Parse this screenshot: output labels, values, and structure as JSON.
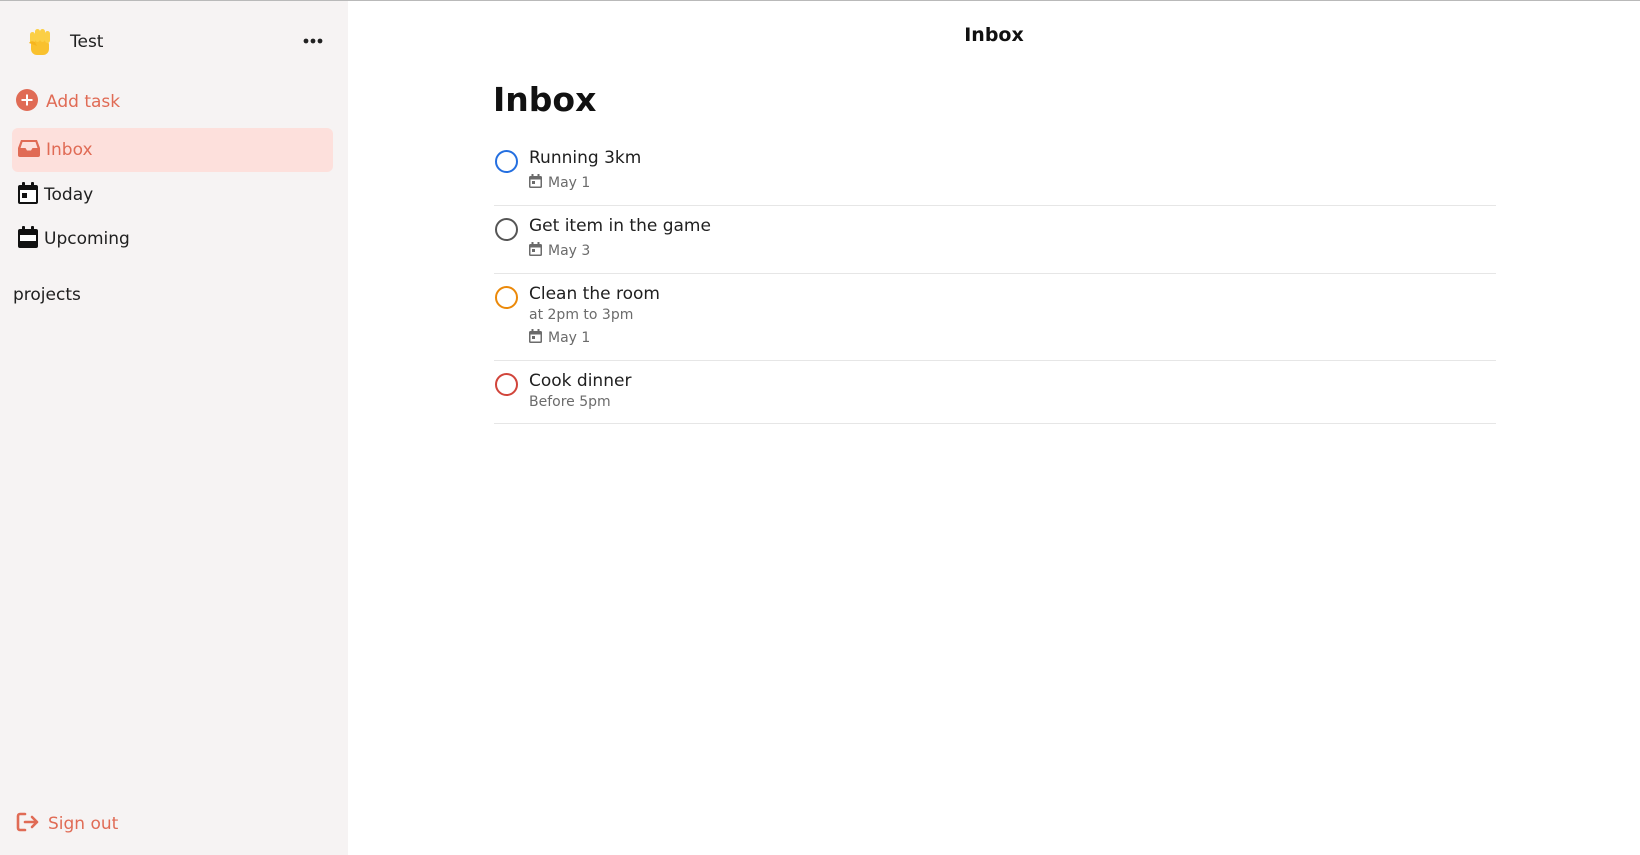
{
  "sidebar": {
    "user": {
      "name": "Test",
      "avatar_icon": "raised-fist-emoji"
    },
    "more_icon": "ellipsis-icon",
    "add_task_label": "Add task",
    "nav": [
      {
        "label": "Inbox",
        "icon": "inbox-icon",
        "active": true
      },
      {
        "label": "Today",
        "icon": "calendar-icon",
        "active": false
      },
      {
        "label": "Upcoming",
        "icon": "calendar-icon",
        "active": false
      }
    ],
    "projects_label": "projects",
    "sign_out_label": "Sign out"
  },
  "main": {
    "header_title": "Inbox",
    "page_title": "Inbox",
    "tasks": [
      {
        "title": "Running 3km",
        "description": "",
        "due": "May 1",
        "priority_color": "#246fe0"
      },
      {
        "title": "Get item in the game",
        "description": "",
        "due": "May 3",
        "priority_color": "#555555"
      },
      {
        "title": "Clean the room",
        "description": "at 2pm to 3pm",
        "due": "May 1",
        "priority_color": "#eb8909"
      },
      {
        "title": "Cook dinner",
        "description": "Before 5pm",
        "due": "",
        "priority_color": "#d1453b"
      }
    ]
  },
  "colors": {
    "accent": "#e06b55",
    "active_bg": "#fde0dc",
    "sidebar_bg": "#f6f3f3"
  }
}
